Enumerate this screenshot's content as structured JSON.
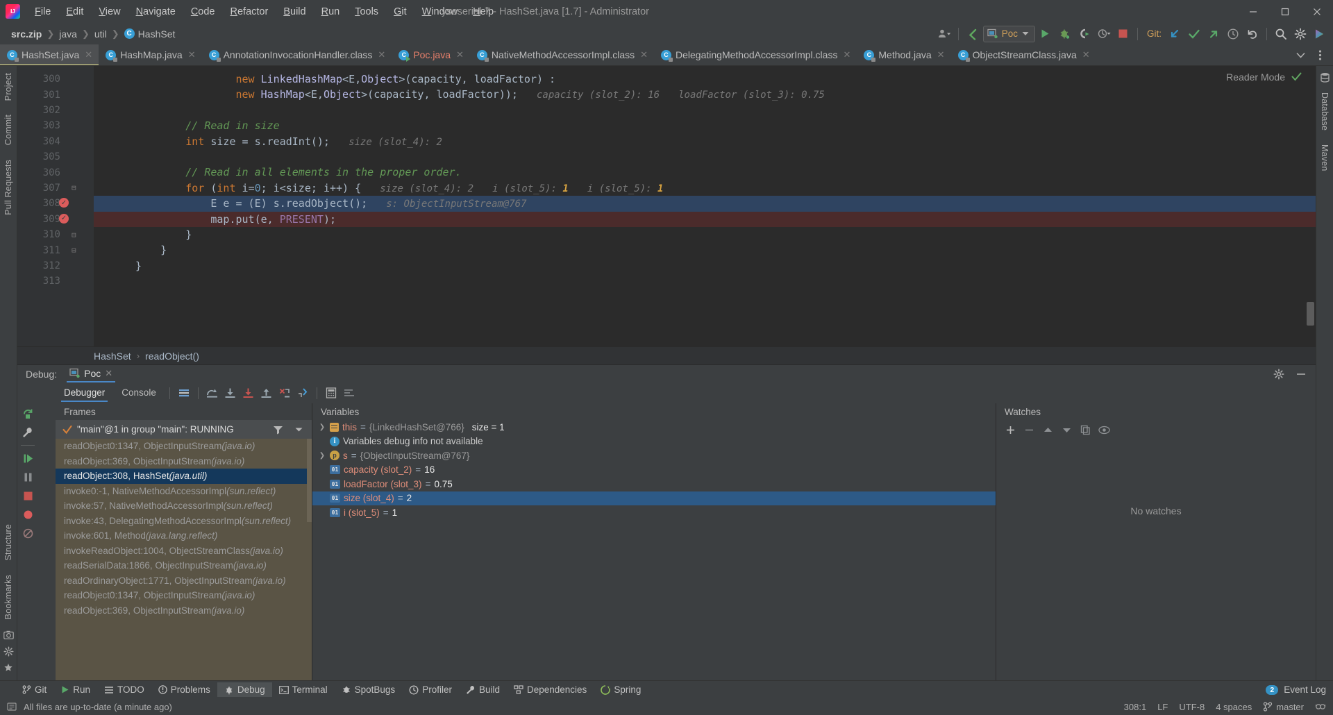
{
  "window": {
    "title": "ysoserial-7 - HashSet.java [1.7] - Administrator",
    "minimize": "−",
    "maximize": "▢",
    "close": "✕"
  },
  "menu": [
    {
      "label": "File"
    },
    {
      "label": "Edit"
    },
    {
      "label": "View"
    },
    {
      "label": "Navigate"
    },
    {
      "label": "Code"
    },
    {
      "label": "Refactor"
    },
    {
      "label": "Build"
    },
    {
      "label": "Run"
    },
    {
      "label": "Tools"
    },
    {
      "label": "Git"
    },
    {
      "label": "Window"
    },
    {
      "label": "Help"
    }
  ],
  "breadcrumbs": [
    {
      "label": "src.zip",
      "bold": true
    },
    {
      "label": "java"
    },
    {
      "label": "util"
    },
    {
      "label": "HashSet",
      "badge": "C"
    }
  ],
  "toolbar": {
    "run_config": "Poc",
    "git_label": "Git:",
    "icons": [
      "user-icon",
      "back-arrow-icon",
      "run-icon",
      "debug-icon",
      "run-coverage-icon",
      "profiler-icon",
      "stop-icon",
      "git-update-icon",
      "git-commit-icon",
      "git-push-icon",
      "history-icon",
      "rollback-icon",
      "search-everywhere-icon",
      "settings-icon",
      "ide-assistant-icon"
    ]
  },
  "editor_tabs": [
    {
      "label": "HashSet.java",
      "active": true,
      "kind": "java"
    },
    {
      "label": "HashMap.java",
      "active": false,
      "kind": "java"
    },
    {
      "label": "AnnotationInvocationHandler.class",
      "active": false,
      "kind": "class"
    },
    {
      "label": "Poc.java",
      "active": false,
      "kind": "runnable"
    },
    {
      "label": "NativeMethodAccessorImpl.class",
      "active": false,
      "kind": "class"
    },
    {
      "label": "DelegatingMethodAccessorImpl.class",
      "active": false,
      "kind": "class"
    },
    {
      "label": "Method.java",
      "active": false,
      "kind": "java"
    },
    {
      "label": "ObjectStreamClass.java",
      "active": false,
      "kind": "java"
    }
  ],
  "editor": {
    "reader_mode": "Reader Mode",
    "breadcrumb_class": "HashSet",
    "breadcrumb_method": "readObject()",
    "lines": [
      {
        "num": "300",
        "indent": 16,
        "tokens": [
          {
            "t": "new ",
            "c": "kw"
          },
          {
            "t": "LinkedHashMap",
            "c": "cls2"
          },
          {
            "t": "<",
            "c": "plain"
          },
          {
            "t": "E",
            "c": "typ2"
          },
          {
            "t": ",",
            "c": "plain"
          },
          {
            "t": "Object",
            "c": "cls2"
          },
          {
            "t": ">(",
            "c": "plain"
          },
          {
            "t": "capacity",
            "c": "plain"
          },
          {
            "t": ", ",
            "c": "plain"
          },
          {
            "t": "loadFactor",
            "c": "plain"
          },
          {
            "t": ") :",
            "c": "plain"
          }
        ]
      },
      {
        "num": "301",
        "indent": 16,
        "tokens": [
          {
            "t": "new ",
            "c": "kw"
          },
          {
            "t": "HashMap",
            "c": "cls2"
          },
          {
            "t": "<",
            "c": "plain"
          },
          {
            "t": "E",
            "c": "typ2"
          },
          {
            "t": ",",
            "c": "plain"
          },
          {
            "t": "Object",
            "c": "cls2"
          },
          {
            "t": ">(",
            "c": "plain"
          },
          {
            "t": "capacity",
            "c": "plain"
          },
          {
            "t": ", ",
            "c": "plain"
          },
          {
            "t": "loadFactor",
            "c": "plain"
          },
          {
            "t": "));",
            "c": "plain"
          }
        ],
        "hints": [
          {
            "text": "capacity (slot_2): 16"
          },
          {
            "text": "loadFactor (slot_3): 0.75"
          }
        ]
      },
      {
        "num": "302",
        "indent": 0,
        "tokens": []
      },
      {
        "num": "303",
        "indent": 8,
        "tokens": [
          {
            "t": "// Read in size",
            "c": "cm"
          }
        ]
      },
      {
        "num": "304",
        "indent": 8,
        "tokens": [
          {
            "t": "int ",
            "c": "kw"
          },
          {
            "t": "size",
            "c": "plain"
          },
          {
            "t": " = ",
            "c": "plain"
          },
          {
            "t": "s",
            "c": "plain"
          },
          {
            "t": ".",
            "c": "plain"
          },
          {
            "t": "readInt",
            "c": "plain"
          },
          {
            "t": "();",
            "c": "plain"
          }
        ],
        "hints": [
          {
            "text": "size (slot_4): 2"
          }
        ]
      },
      {
        "num": "305",
        "indent": 0,
        "tokens": []
      },
      {
        "num": "306",
        "indent": 8,
        "tokens": [
          {
            "t": "// Read in all elements in the proper order.",
            "c": "cm"
          }
        ]
      },
      {
        "num": "307",
        "indent": 8,
        "fold": true,
        "tokens": [
          {
            "t": "for ",
            "c": "kw"
          },
          {
            "t": "(",
            "c": "plain"
          },
          {
            "t": "int ",
            "c": "kw"
          },
          {
            "t": "i",
            "c": "plain"
          },
          {
            "t": "=",
            "c": "plain"
          },
          {
            "t": "0",
            "c": "num"
          },
          {
            "t": "; ",
            "c": "plain"
          },
          {
            "t": "i",
            "c": "plain"
          },
          {
            "t": "<",
            "c": "plain"
          },
          {
            "t": "size",
            "c": "plain"
          },
          {
            "t": "; ",
            "c": "plain"
          },
          {
            "t": "i",
            "c": "plain"
          },
          {
            "t": "++) {",
            "c": "plain"
          }
        ],
        "hints": [
          {
            "text": "size (slot_4): 2"
          },
          {
            "text": "i (slot_5): ",
            "hl": "1"
          },
          {
            "text": "i (slot_5): ",
            "hl": "1"
          }
        ]
      },
      {
        "num": "308",
        "indent": 12,
        "bp": true,
        "exec": true,
        "tokens": [
          {
            "t": "E",
            "c": "typ2"
          },
          {
            "t": " e = (",
            "c": "plain"
          },
          {
            "t": "E",
            "c": "typ2"
          },
          {
            "t": ") ",
            "c": "plain"
          },
          {
            "t": "s",
            "c": "plain"
          },
          {
            "t": ".",
            "c": "plain"
          },
          {
            "t": "readObject",
            "c": "plain"
          },
          {
            "t": "();",
            "c": "plain"
          }
        ],
        "hints": [
          {
            "text": "s: ObjectInputStream@767"
          }
        ]
      },
      {
        "num": "309",
        "indent": 12,
        "bp": true,
        "bpline": true,
        "tokens": [
          {
            "t": "map",
            "c": "plain"
          },
          {
            "t": ".",
            "c": "plain"
          },
          {
            "t": "put",
            "c": "plain"
          },
          {
            "t": "(e, ",
            "c": "plain"
          },
          {
            "t": "PRESENT",
            "c": "sf"
          },
          {
            "t": ");",
            "c": "plain"
          }
        ]
      },
      {
        "num": "310",
        "indent": 8,
        "fold": true,
        "tokens": [
          {
            "t": "}",
            "c": "plain"
          }
        ]
      },
      {
        "num": "311",
        "indent": 4,
        "fold": true,
        "tokens": [
          {
            "t": "}",
            "c": "plain"
          }
        ]
      },
      {
        "num": "312",
        "indent": 0,
        "tokens": [
          {
            "t": "}",
            "c": "plain"
          }
        ]
      },
      {
        "num": "313",
        "indent": 0,
        "tokens": []
      }
    ]
  },
  "debug": {
    "panel_label": "Debug:",
    "session_tab": "Poc",
    "tabs": [
      {
        "label": "Debugger",
        "active": true
      },
      {
        "label": "Console",
        "active": false
      }
    ],
    "frames_title": "Frames",
    "variables_title": "Variables",
    "watches_title": "Watches",
    "thread": "\"main\"@1 in group \"main\": RUNNING",
    "frames": [
      {
        "label": "readObject0:1347, ObjectInputStream ",
        "pkg": "(java.io)",
        "selected": false
      },
      {
        "label": "readObject:369, ObjectInputStream ",
        "pkg": "(java.io)",
        "selected": false
      },
      {
        "label": "readObject:308, HashSet ",
        "pkg": "(java.util)",
        "selected": true
      },
      {
        "label": "invoke0:-1, NativeMethodAccessorImpl ",
        "pkg": "(sun.reflect)",
        "selected": false
      },
      {
        "label": "invoke:57, NativeMethodAccessorImpl ",
        "pkg": "(sun.reflect)",
        "selected": false
      },
      {
        "label": "invoke:43, DelegatingMethodAccessorImpl ",
        "pkg": "(sun.reflect)",
        "selected": false
      },
      {
        "label": "invoke:601, Method ",
        "pkg": "(java.lang.reflect)",
        "selected": false
      },
      {
        "label": "invokeReadObject:1004, ObjectStreamClass ",
        "pkg": "(java.io)",
        "selected": false
      },
      {
        "label": "readSerialData:1866, ObjectInputStream ",
        "pkg": "(java.io)",
        "selected": false
      },
      {
        "label": "readOrdinaryObject:1771, ObjectInputStream ",
        "pkg": "(java.io)",
        "selected": false
      },
      {
        "label": "readObject0:1347, ObjectInputStream ",
        "pkg": "(java.io)",
        "selected": false
      },
      {
        "label": "readObject:369, ObjectInputStream ",
        "pkg": "(java.io)",
        "selected": false
      }
    ],
    "variables": [
      {
        "icon": "object",
        "arrow": true,
        "name": "this",
        "eq": " = ",
        "value": "{LinkedHashSet@766}",
        "extra": "size = 1",
        "selected": false
      },
      {
        "icon": "info",
        "arrow": false,
        "text": "Variables debug info not available",
        "selected": false
      },
      {
        "icon": "param",
        "arrow": true,
        "name": "s",
        "eq": " = ",
        "value": "{ObjectInputStream@767}",
        "selected": false
      },
      {
        "icon": "primitive",
        "arrow": false,
        "name": "capacity (slot_2)",
        "eq": " = ",
        "num": "16",
        "selected": false
      },
      {
        "icon": "primitive",
        "arrow": false,
        "name": "loadFactor (slot_3)",
        "eq": " = ",
        "num": "0.75",
        "selected": false
      },
      {
        "icon": "primitive",
        "arrow": false,
        "name": "size (slot_4)",
        "eq": " = ",
        "num": "2",
        "selected": true
      },
      {
        "icon": "primitive",
        "arrow": false,
        "name": "i (slot_5)",
        "eq": " = ",
        "num": "1",
        "selected": false
      }
    ],
    "no_watches": "No watches"
  },
  "tool_windows": [
    {
      "label": "Git",
      "icon": "git-icon",
      "active": false
    },
    {
      "label": "Run",
      "icon": "run-icon",
      "active": false
    },
    {
      "label": "TODO",
      "icon": "todo-icon",
      "active": false
    },
    {
      "label": "Problems",
      "icon": "problems-icon",
      "active": false
    },
    {
      "label": "Debug",
      "icon": "debug-icon",
      "active": true
    },
    {
      "label": "Terminal",
      "icon": "terminal-icon",
      "active": false
    },
    {
      "label": "SpotBugs",
      "icon": "spotbugs-icon",
      "active": false
    },
    {
      "label": "Profiler",
      "icon": "profiler-icon",
      "active": false
    },
    {
      "label": "Build",
      "icon": "build-icon",
      "active": false
    },
    {
      "label": "Dependencies",
      "icon": "dependencies-icon",
      "active": false
    },
    {
      "label": "Spring",
      "icon": "spring-icon",
      "active": false
    }
  ],
  "event_log": {
    "count": "2",
    "label": "Event Log"
  },
  "left_bars": [
    "Project",
    "Commit",
    "Pull Requests"
  ],
  "left_bars_bottom": [
    "Structure",
    "Bookmarks"
  ],
  "right_bars": [
    "Database",
    "Maven"
  ],
  "statusbar": {
    "message": "All files are up-to-date (a minute ago)",
    "caret": "308:1",
    "line_sep": "LF",
    "encoding": "UTF-8",
    "indent": "4 spaces",
    "branch": "master"
  }
}
